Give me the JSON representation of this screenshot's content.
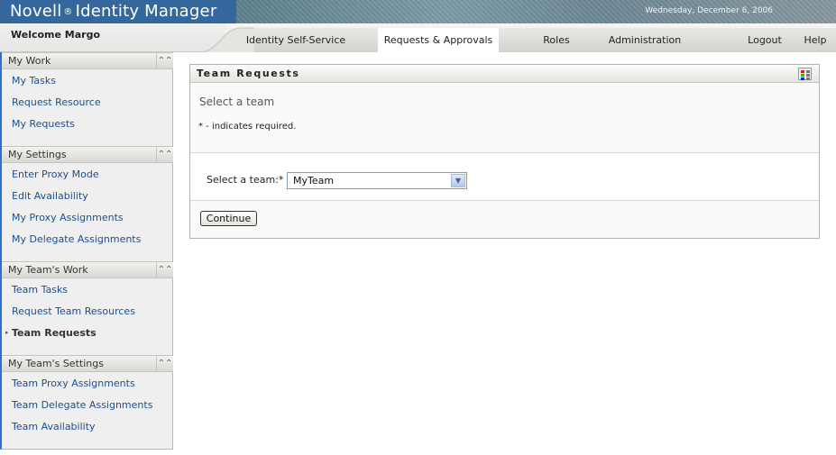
{
  "app": {
    "brand": "Novell",
    "brand_mark": "®",
    "product": "Identity Manager",
    "date": "Wednesday, December 6, 2006",
    "welcome": "Welcome Margo"
  },
  "nav": {
    "tabs": [
      {
        "label": "Identity Self-Service",
        "active": false
      },
      {
        "label": "Requests & Approvals",
        "active": true
      },
      {
        "label": "Roles",
        "active": false
      },
      {
        "label": "Administration",
        "active": false
      }
    ],
    "logout": "Logout",
    "help": "Help"
  },
  "sidebar": {
    "sections": [
      {
        "title": "My Work",
        "items": [
          "My Tasks",
          "Request Resource",
          "My Requests"
        ]
      },
      {
        "title": "My Settings",
        "items": [
          "Enter Proxy Mode",
          "Edit Availability",
          "My Proxy Assignments",
          "My Delegate Assignments"
        ]
      },
      {
        "title": "My Team's Work",
        "items": [
          "Team Tasks",
          "Request Team Resources",
          "Team Requests"
        ],
        "current": "Team Requests"
      },
      {
        "title": "My Team's Settings",
        "items": [
          "Team Proxy Assignments",
          "Team Delegate Assignments",
          "Team Availability"
        ]
      }
    ],
    "collapse_icon": "double-chevron-up-icon",
    "current_marker": "▸"
  },
  "panel": {
    "title": "Team Requests",
    "description": "Select a team",
    "required_note": "* - indicates required.",
    "field_label": "Select a team:*",
    "select_value": "MyTeam",
    "continue_label": "Continue",
    "menu_icon_colors": [
      "#e02020",
      "#20c020",
      "#2020d0"
    ]
  }
}
